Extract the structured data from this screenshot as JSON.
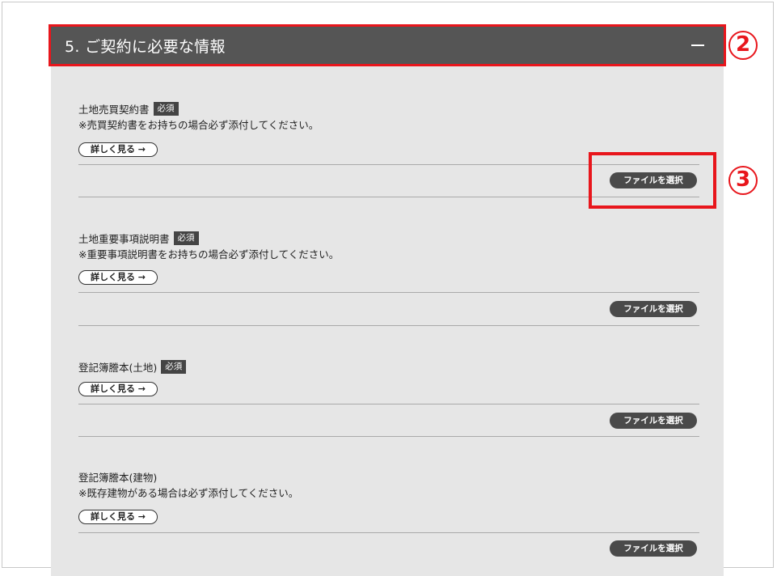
{
  "section": {
    "title": "5. ご契約に必要な情報",
    "collapse_icon": "minus-icon"
  },
  "annotations": {
    "header_marker": "2",
    "button_marker": "3",
    "color": "#e8161c"
  },
  "items": [
    {
      "title": "土地売買契約書",
      "required": "必須",
      "note": "※売買契約書をお持ちの場合必ず添付してください。",
      "details_label": "詳しく見る →",
      "file_label": "ファイルを選択"
    },
    {
      "title": "土地重要事項説明書",
      "required": "必須",
      "note": "※重要事項説明書をお持ちの場合必ず添付してください。",
      "details_label": "詳しく見る →",
      "file_label": "ファイルを選択"
    },
    {
      "title": "登記簿謄本(土地)",
      "required": "必須",
      "note": "",
      "details_label": "詳しく見る →",
      "file_label": "ファイルを選択"
    },
    {
      "title": "登記簿謄本(建物)",
      "required": "",
      "note": "※既存建物がある場合は必ず添付してください。",
      "details_label": "詳しく見る →",
      "file_label": "ファイルを選択"
    }
  ],
  "colors": {
    "header_bg": "#555555",
    "panel_bg": "#e6e6e6",
    "button_bg": "#4a4a4a"
  }
}
